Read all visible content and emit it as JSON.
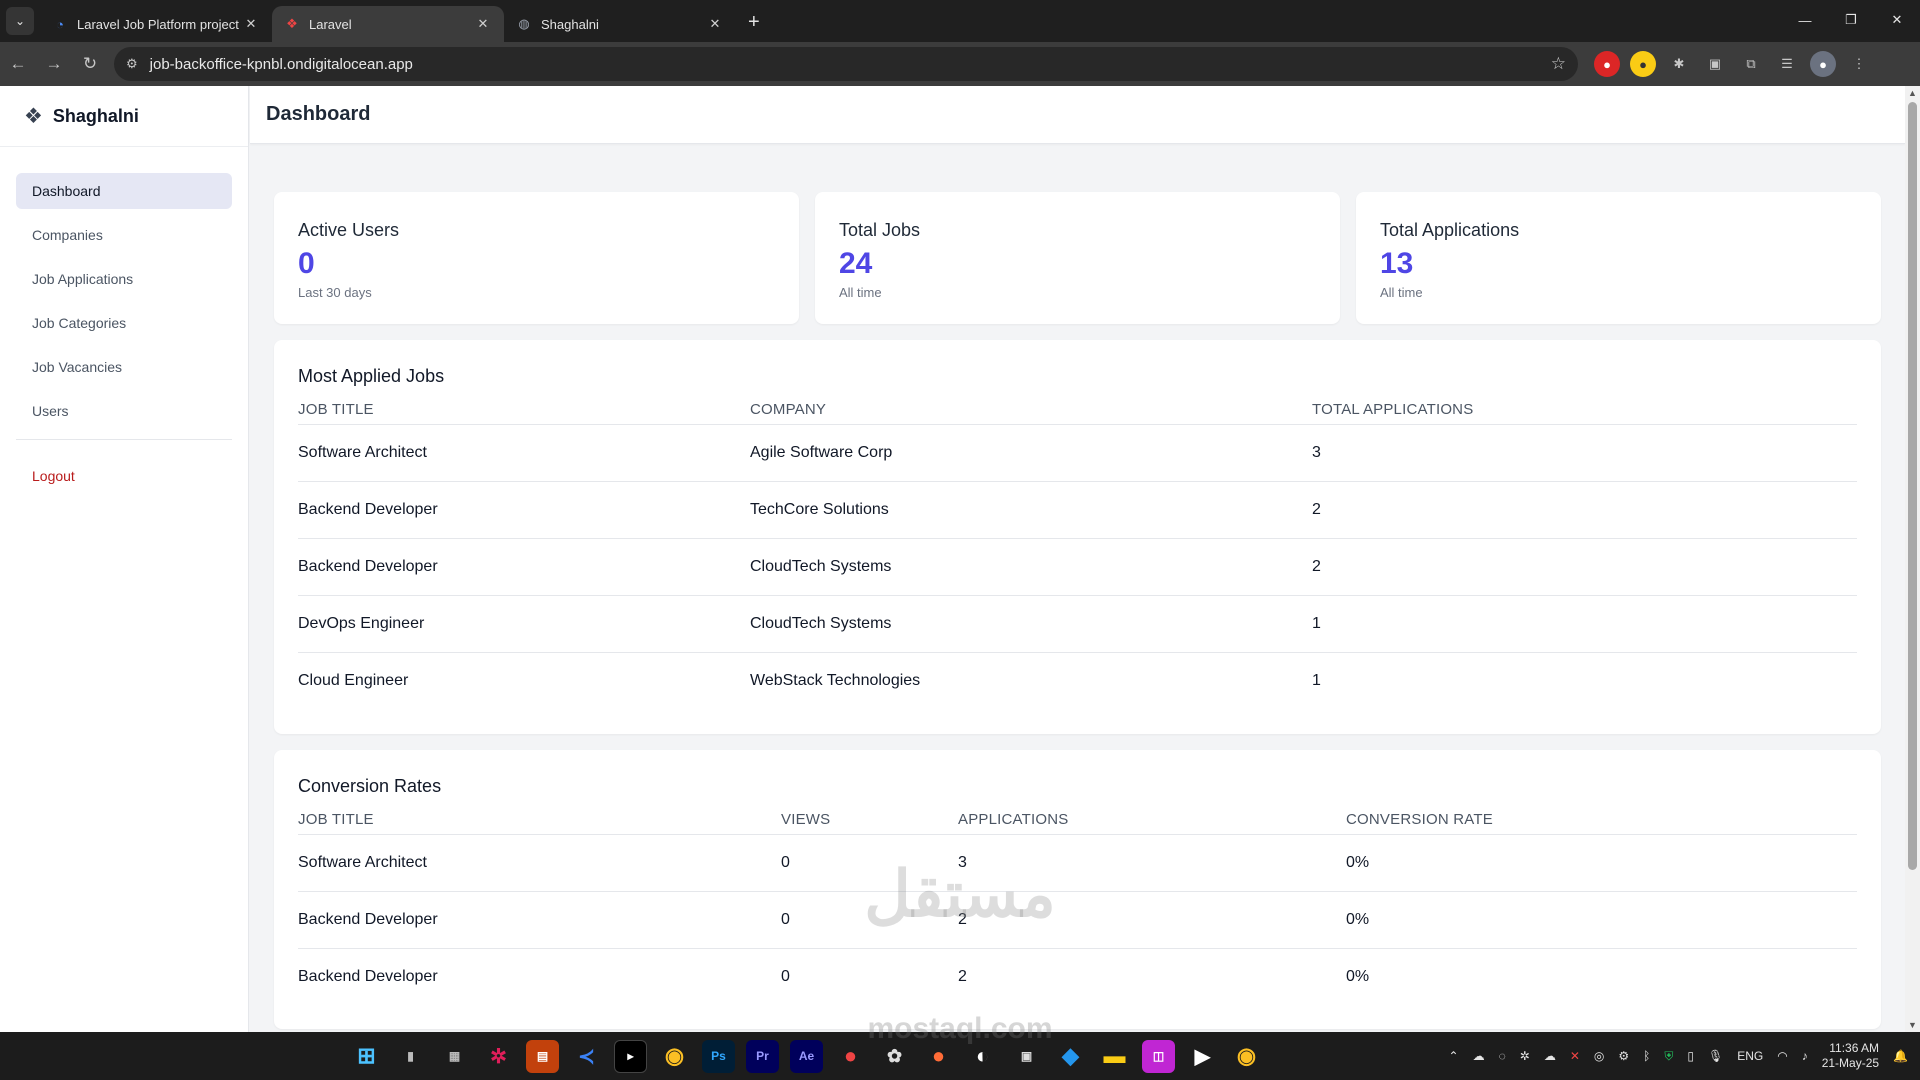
{
  "browser": {
    "tabs": [
      {
        "title": "Laravel Job Platform project - D",
        "active": false,
        "favicon": "#4c8bf5"
      },
      {
        "title": "Laravel",
        "active": true,
        "favicon": "#ef4444"
      },
      {
        "title": "Shaghalni",
        "active": false,
        "favicon": "#9ca3af"
      }
    ],
    "url": "job-backoffice-kpnbl.ondigitalocean.app"
  },
  "brand": {
    "name": "Shaghalni"
  },
  "sidebar": {
    "items": [
      {
        "label": "Dashboard",
        "active": true
      },
      {
        "label": "Companies"
      },
      {
        "label": "Job Applications"
      },
      {
        "label": "Job Categories"
      },
      {
        "label": "Job Vacancies"
      },
      {
        "label": "Users"
      }
    ],
    "logout": "Logout"
  },
  "header": {
    "title": "Dashboard"
  },
  "stats": [
    {
      "label": "Active Users",
      "value": "0",
      "sub": "Last 30 days"
    },
    {
      "label": "Total Jobs",
      "value": "24",
      "sub": "All time"
    },
    {
      "label": "Total Applications",
      "value": "13",
      "sub": "All time"
    }
  ],
  "most_applied": {
    "title": "Most Applied Jobs",
    "columns": [
      "JOB TITLE",
      "COMPANY",
      "TOTAL APPLICATIONS"
    ],
    "rows": [
      [
        "Software Architect",
        "Agile Software Corp",
        "3"
      ],
      [
        "Backend Developer",
        "TechCore Solutions",
        "2"
      ],
      [
        "Backend Developer",
        "CloudTech Systems",
        "2"
      ],
      [
        "DevOps Engineer",
        "CloudTech Systems",
        "1"
      ],
      [
        "Cloud Engineer",
        "WebStack Technologies",
        "1"
      ]
    ]
  },
  "conversion": {
    "title": "Conversion Rates",
    "columns": [
      "JOB TITLE",
      "VIEWS",
      "APPLICATIONS",
      "CONVERSION RATE"
    ],
    "rows": [
      [
        "Software Architect",
        "0",
        "3",
        "0%"
      ],
      [
        "Backend Developer",
        "0",
        "2",
        "0%"
      ],
      [
        "Backend Developer",
        "0",
        "2",
        "0%"
      ]
    ]
  },
  "watermark": {
    "text": "مستقل",
    "sub": "mostaql.com"
  },
  "taskbar": {
    "lang": "ENG",
    "time": "11:36 AM",
    "date": "21-May-25"
  }
}
